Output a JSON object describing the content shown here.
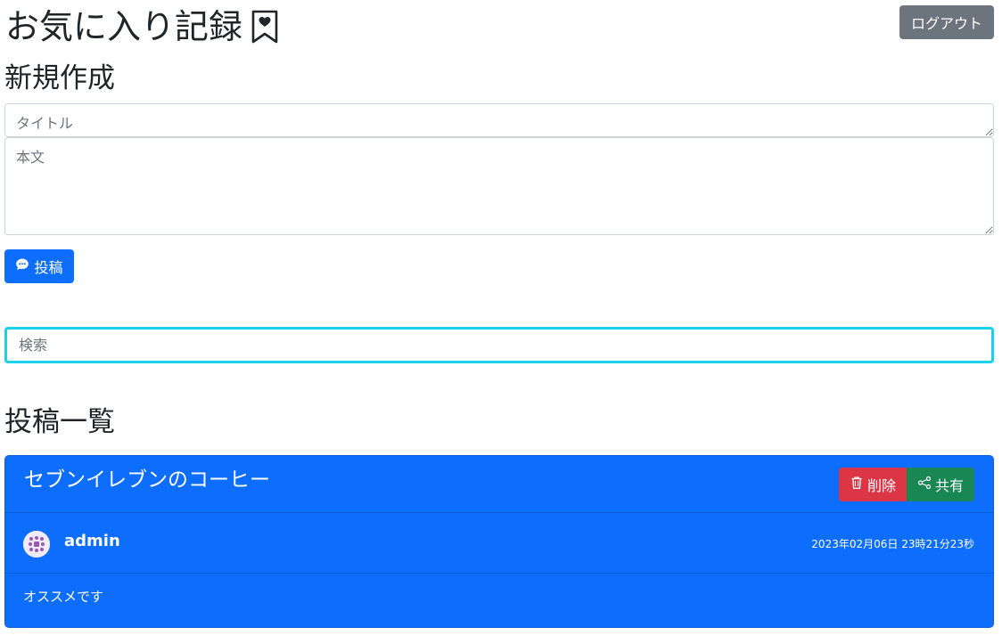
{
  "header": {
    "title": "お気に入り記録",
    "logout_label": "ログアウト"
  },
  "new_post": {
    "heading": "新規作成",
    "title_placeholder": "タイトル",
    "body_placeholder": "本文",
    "submit_label": "投稿"
  },
  "search": {
    "placeholder": "検索"
  },
  "list": {
    "heading": "投稿一覧",
    "posts": [
      {
        "title": "セブンイレブンのコーヒー",
        "delete_label": "削除",
        "share_label": "共有",
        "username": "admin",
        "timestamp": "2023年02月06日 23時21分23秒",
        "body": "オススメです"
      }
    ]
  },
  "colors": {
    "primary": "#0d6efd",
    "secondary": "#6c757d",
    "danger": "#dc3545",
    "success": "#198754",
    "search_focus": "#1ad1ee"
  },
  "icons": {
    "bookmark": "bookmark-heart-icon",
    "post": "chat-icon",
    "delete": "trash-icon",
    "share": "share-icon",
    "avatar": "identicon-avatar"
  }
}
